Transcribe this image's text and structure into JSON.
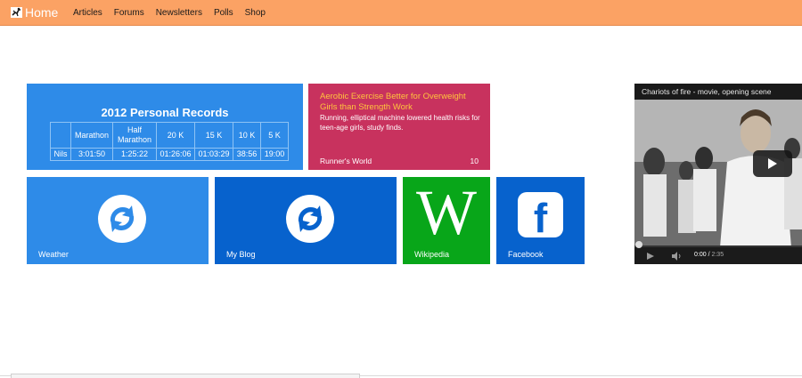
{
  "nav": {
    "home": "Home",
    "items": [
      "Articles",
      "Forums",
      "Newsletters",
      "Polls",
      "Shop"
    ]
  },
  "records": {
    "title": "2012 Personal Records",
    "columns": [
      "",
      "Marathon",
      "Half Marathon",
      "20 K",
      "15 K",
      "10 K",
      "5 K"
    ],
    "row": [
      "Nils",
      "3:01:50",
      "1:25:22",
      "01:26:06",
      "01:03:29",
      "38:56",
      "19:00"
    ]
  },
  "news": {
    "title": "Aerobic Exercise Better for Overweight Girls than Strength Work",
    "body": "Running, elliptical machine lowered health risks for teen-age girls, study finds.",
    "source": "Runner's World",
    "count": "10"
  },
  "tiles": {
    "weather": "Weather",
    "blog": "My Blog",
    "wiki": "Wikipedia",
    "wiki_letter": "W",
    "facebook": "Facebook",
    "facebook_letter": "f"
  },
  "video": {
    "title": "Chariots of fire - movie, opening scene",
    "current": "0:00",
    "duration": "2:35"
  },
  "colors": {
    "topbar": "#fba264",
    "tile_blue": "#2e8be8",
    "tile_dark_blue": "#0762cd",
    "tile_red": "#c8325e",
    "tile_green": "#08a619",
    "news_title": "#ffc43d"
  }
}
